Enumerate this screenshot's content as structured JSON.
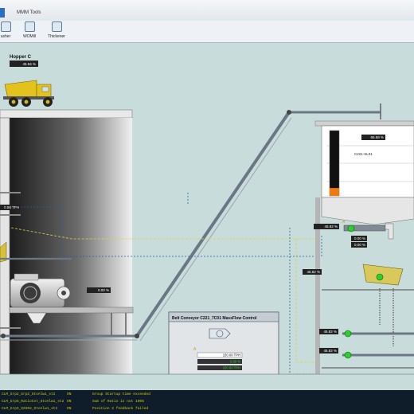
{
  "window": {
    "title": "MMM Tools"
  },
  "toolbar": {
    "items": [
      {
        "label": "usher"
      },
      {
        "label": "WOMill"
      },
      {
        "label": "Thickener"
      }
    ]
  },
  "hopper": {
    "label": "Hopper C",
    "value": "45.94 %"
  },
  "left_level": {
    "value": "0.58 TPH"
  },
  "crusher_value": {
    "value": "0.00 %"
  },
  "bin": {
    "label": "C221-SL01",
    "value": "65.58 %",
    "fill_fraction": 0.12
  },
  "screen": {
    "value1": "45.82 %",
    "value2": "0.00 %",
    "value3": "0.00 %"
  },
  "right_side": {
    "value1": "45.82 %",
    "value2": "45.82 %",
    "value3": "45.82 %"
  },
  "mass_flow": {
    "title": "Belt Conveyor C221_7C01 MassFlow Control",
    "mode": "A",
    "setpoint": "150.00 TPH",
    "actual": "0.00 %",
    "output": "150.00 TPH"
  },
  "alarms": [
    {
      "tag": "CLM_Grp2_Grp2_StoAlw1_st2",
      "state": "ON",
      "message": "Group Startup time exceeded"
    },
    {
      "tag": "CLM_Grp5_RatioCnt_StoAlw1_st2",
      "state": "ON",
      "message": "Sum of Ratio is not 100%"
    },
    {
      "tag": "CLM_Grp3_XZ202_StoAlw1_st2",
      "state": "ON",
      "message": "Position 2 feedback failed"
    }
  ],
  "colors": {
    "status_green": "#2bd12b",
    "alarm_text": "#d8c600",
    "bin_fill": "#f07a10"
  }
}
